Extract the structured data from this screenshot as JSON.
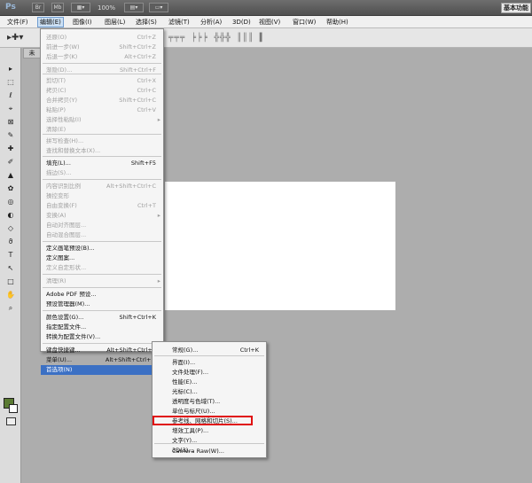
{
  "titlebar": {
    "logo": "Ps",
    "br_icon": "Br",
    "mb_icon": "Mb",
    "zoom": "100%",
    "workspace": "基本功能"
  },
  "menubar": {
    "items": [
      "文件(F)",
      "编辑(E)",
      "图像(I)",
      "图层(L)",
      "选择(S)",
      "滤镜(T)",
      "分析(A)",
      "3D(D)",
      "视图(V)",
      "窗口(W)",
      "帮助(H)"
    ]
  },
  "optionsbar": {
    "align_glyphs": "╤╤╤ ╞╞╞ ╬╬╬ ║║║ ▌"
  },
  "doc_tab": "未",
  "edit_menu": {
    "items": [
      {
        "label": "还原(O)",
        "shortcut": "Ctrl+Z",
        "enabled": false
      },
      {
        "label": "前进一步(W)",
        "shortcut": "Shift+Ctrl+Z",
        "enabled": false
      },
      {
        "label": "后退一步(K)",
        "shortcut": "Alt+Ctrl+Z",
        "enabled": false
      },
      {
        "label": "渐隐(D)...",
        "shortcut": "Shift+Ctrl+F",
        "enabled": false
      },
      {
        "label": "剪切(T)",
        "shortcut": "Ctrl+X",
        "enabled": false
      },
      {
        "label": "拷贝(C)",
        "shortcut": "Ctrl+C",
        "enabled": false
      },
      {
        "label": "合并拷贝(Y)",
        "shortcut": "Shift+Ctrl+C",
        "enabled": false
      },
      {
        "label": "粘贴(P)",
        "shortcut": "Ctrl+V",
        "enabled": false
      },
      {
        "label": "选择性粘贴(I)",
        "shortcut": "",
        "enabled": false,
        "submenu": true
      },
      {
        "label": "清除(E)",
        "shortcut": "",
        "enabled": false
      },
      {
        "label": "拼写检查(H)...",
        "shortcut": "",
        "enabled": false
      },
      {
        "label": "查找和替换文本(X)...",
        "shortcut": "",
        "enabled": false
      },
      {
        "label": "填充(L)...",
        "shortcut": "Shift+F5",
        "enabled": true
      },
      {
        "label": "描边(S)...",
        "shortcut": "",
        "enabled": false
      },
      {
        "label": "内容识别比例",
        "shortcut": "Alt+Shift+Ctrl+C",
        "enabled": false
      },
      {
        "label": "操控变形",
        "shortcut": "",
        "enabled": false
      },
      {
        "label": "自由变换(F)",
        "shortcut": "Ctrl+T",
        "enabled": false
      },
      {
        "label": "变换(A)",
        "shortcut": "",
        "enabled": false,
        "submenu": true
      },
      {
        "label": "自动对齐图层...",
        "shortcut": "",
        "enabled": false
      },
      {
        "label": "自动混合图层...",
        "shortcut": "",
        "enabled": false
      },
      {
        "label": "定义画笔预设(B)...",
        "shortcut": "",
        "enabled": true
      },
      {
        "label": "定义图案...",
        "shortcut": "",
        "enabled": true
      },
      {
        "label": "定义自定形状...",
        "shortcut": "",
        "enabled": false
      },
      {
        "label": "清理(R)",
        "shortcut": "",
        "enabled": false,
        "submenu": true
      },
      {
        "label": "Adobe PDF 预设...",
        "shortcut": "",
        "enabled": true
      },
      {
        "label": "预设管理器(M)...",
        "shortcut": "",
        "enabled": true
      },
      {
        "label": "颜色设置(G)...",
        "shortcut": "Shift+Ctrl+K",
        "enabled": true
      },
      {
        "label": "指定配置文件...",
        "shortcut": "",
        "enabled": true
      },
      {
        "label": "转换为配置文件(V)...",
        "shortcut": "",
        "enabled": true
      },
      {
        "label": "键盘快捷键...",
        "shortcut": "Alt+Shift+Ctrl+K",
        "enabled": true
      },
      {
        "label": "菜单(U)...",
        "shortcut": "Alt+Shift+Ctrl+M",
        "enabled": true
      },
      {
        "label": "首选项(N)",
        "shortcut": "",
        "enabled": true,
        "submenu": true,
        "highlighted": true
      }
    ]
  },
  "pref_menu": {
    "items": [
      {
        "label": "常规(G)...",
        "shortcut": "Ctrl+K"
      },
      {
        "label": "界面(I)...",
        "shortcut": ""
      },
      {
        "label": "文件处理(F)...",
        "shortcut": ""
      },
      {
        "label": "性能(E)...",
        "shortcut": ""
      },
      {
        "label": "光标(C)...",
        "shortcut": ""
      },
      {
        "label": "透明度与色域(T)...",
        "shortcut": ""
      },
      {
        "label": "单位与标尺(U)...",
        "shortcut": ""
      },
      {
        "label": "参考线、网格和切片(S)...",
        "shortcut": ""
      },
      {
        "label": "增效工具(P)...",
        "shortcut": ""
      },
      {
        "label": "文字(Y)...",
        "shortcut": ""
      },
      {
        "label": "3D(3)...",
        "shortcut": ""
      },
      {
        "label": "Camera Raw(W)...",
        "shortcut": ""
      }
    ]
  },
  "tools": [
    "▸",
    "⬚",
    "ℓ",
    "⌖",
    "⊠",
    "✎",
    "✚",
    "✐",
    "▲",
    "✿",
    "◎",
    "◐",
    "◇",
    "ϑ",
    "T",
    "↖",
    "□",
    "✋",
    "⌕"
  ],
  "colors": {
    "accent": "#3b70c4",
    "annotation": "#e01010",
    "foreground": "#5a7a32"
  }
}
